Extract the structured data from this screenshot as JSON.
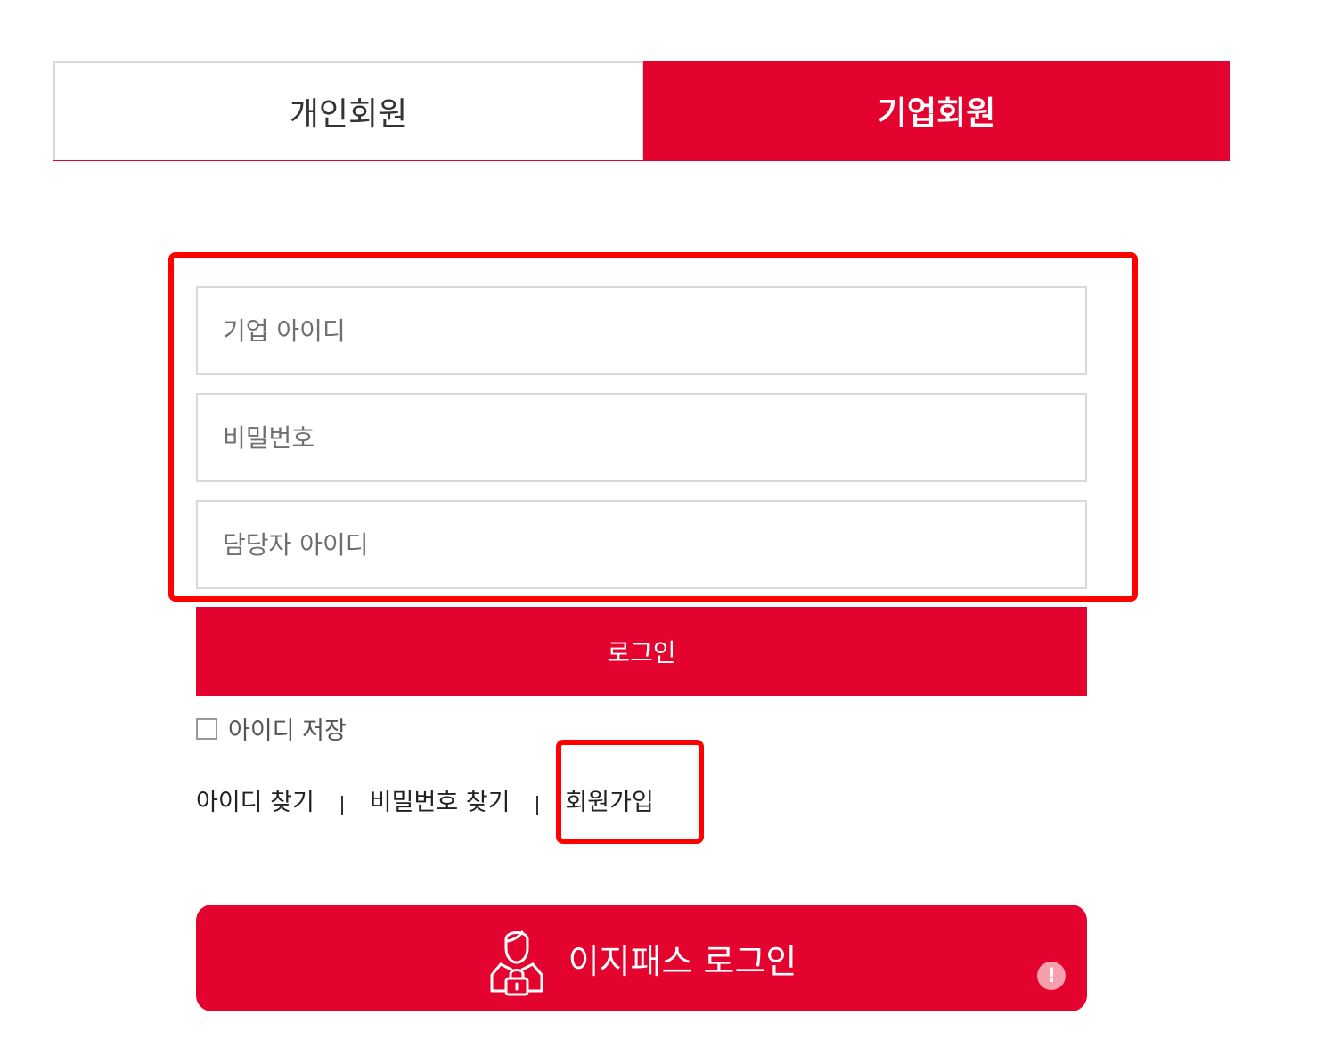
{
  "tabs": {
    "personal": "개인회원",
    "corporate": "기업회원",
    "active": "corporate"
  },
  "form": {
    "company_id_placeholder": "기업 아이디",
    "password_placeholder": "비밀번호",
    "manager_id_placeholder": "담당자 아이디",
    "login_label": "로그인",
    "save_id_label": "아이디 저장",
    "save_id_checked": false
  },
  "links": {
    "find_id": "아이디 찾기",
    "find_password": "비밀번호 찾기",
    "signup": "회원가입"
  },
  "easypass": {
    "label": "이지패스 로그인",
    "icon": "user-lock-icon",
    "info_badge": "!"
  },
  "colors": {
    "brand_red": "#e4032e",
    "highlight": "#ff0000"
  }
}
